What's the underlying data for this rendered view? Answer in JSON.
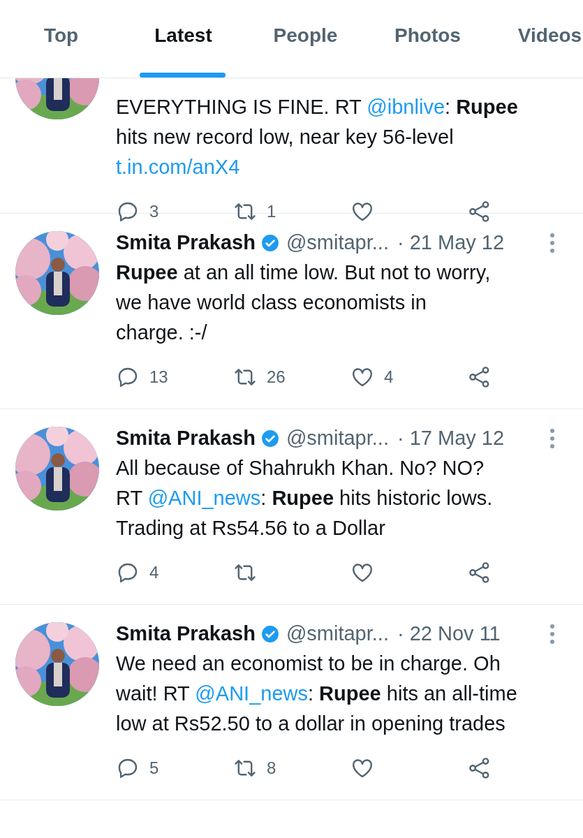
{
  "tabs": [
    {
      "label": "Top",
      "selected": false
    },
    {
      "label": "Latest",
      "selected": true
    },
    {
      "label": "People",
      "selected": false
    },
    {
      "label": "Photos",
      "selected": false
    },
    {
      "label": "Videos",
      "selected": false
    }
  ],
  "tweets": [
    {
      "lines": [
        [
          {
            "kind": "text",
            "t": "EVERYTHING IS FINE. RT "
          },
          {
            "kind": "link",
            "t": "@ibnlive"
          },
          {
            "kind": "text",
            "t": ": "
          },
          {
            "kind": "bold",
            "t": "Rupee"
          }
        ],
        [
          {
            "kind": "text",
            "t": "hits new record low, near key 56-level"
          }
        ],
        [
          {
            "kind": "link",
            "t": "t.in.com/anX4"
          }
        ]
      ],
      "replies": "3",
      "retweets": "1"
    },
    {
      "author": {
        "name": "Smita Prakash",
        "verified": true,
        "handle": "@smitapr...",
        "date": "· 21 May 12"
      },
      "lines": [
        [
          {
            "kind": "bold",
            "t": "Rupee"
          },
          {
            "kind": "text",
            "t": " at an all time low. But not to worry,"
          }
        ],
        [
          {
            "kind": "text",
            "t": "we have world class economists in"
          }
        ],
        [
          {
            "kind": "text",
            "t": "charge. :-/"
          }
        ]
      ],
      "replies": "13",
      "retweets": "26",
      "likes": "4"
    },
    {
      "author": {
        "name": "Smita Prakash",
        "verified": true,
        "handle": "@smitapr...",
        "date": "· 17 May 12"
      },
      "lines": [
        [
          {
            "kind": "text",
            "t": "All because of Shahrukh Khan. No? NO?"
          }
        ],
        [
          {
            "kind": "text",
            "t": "RT "
          },
          {
            "kind": "link",
            "t": "@ANI_news"
          },
          {
            "kind": "text",
            "t": ": "
          },
          {
            "kind": "bold",
            "t": "Rupee"
          },
          {
            "kind": "text",
            "t": " hits historic lows."
          }
        ],
        [
          {
            "kind": "text",
            "t": "Trading at Rs54.56 to a Dollar"
          }
        ]
      ],
      "replies": "4"
    },
    {
      "author": {
        "name": "Smita Prakash",
        "verified": true,
        "handle": "@smitapr...",
        "date": "· 22 Nov 11"
      },
      "lines": [
        [
          {
            "kind": "text",
            "t": "We need an economist to be in charge. Oh"
          }
        ],
        [
          {
            "kind": "text",
            "t": "wait! RT "
          },
          {
            "kind": "link",
            "t": "@ANI_news"
          },
          {
            "kind": "text",
            "t": ": "
          },
          {
            "kind": "bold",
            "t": "Rupee"
          },
          {
            "kind": "text",
            "t": " hits an all-time"
          }
        ],
        [
          {
            "kind": "text",
            "t": "low at Rs52.50 to a dollar in opening trades"
          }
        ]
      ],
      "replies": "5",
      "retweets": "8"
    }
  ]
}
